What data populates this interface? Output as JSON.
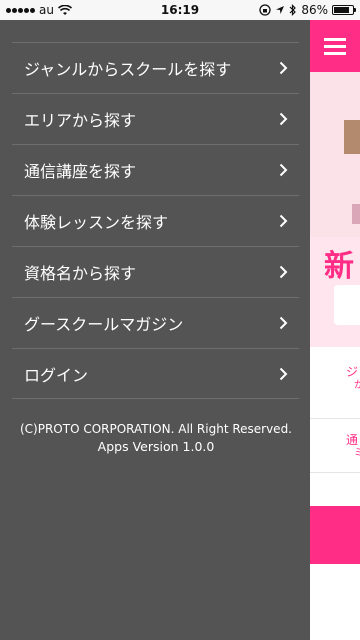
{
  "status_bar": {
    "carrier": "au",
    "time": "16:19",
    "battery_percent": "86%",
    "battery_level": 0.86
  },
  "menu": {
    "items": [
      {
        "label": "ジャンルからスクールを探す",
        "icon": "chevron-right-icon"
      },
      {
        "label": "エリアから探す",
        "icon": "chevron-right-icon"
      },
      {
        "label": "通信講座を探す",
        "icon": "chevron-right-icon"
      },
      {
        "label": "体験レッスンを探す",
        "icon": "chevron-right-icon"
      },
      {
        "label": "資格名から探す",
        "icon": "chevron-right-icon"
      },
      {
        "label": "グースクールマガジン",
        "icon": "chevron-right-icon"
      },
      {
        "label": "ログイン",
        "icon": "chevron-right-icon"
      }
    ]
  },
  "footer": {
    "copyright": "(C)PROTO CORPORATION. All Right Reserved.",
    "version": "Apps Version 1.0.0"
  },
  "app_behind": {
    "headline_fragment": "新",
    "list": [
      {
        "line1": "ジ",
        "line2": "か"
      },
      {
        "line1": "通",
        "line2": "ミ"
      }
    ]
  },
  "colors": {
    "drawer_bg": "#545454",
    "accent_pink": "#ff2d86",
    "divider": "#6e6e6e"
  }
}
